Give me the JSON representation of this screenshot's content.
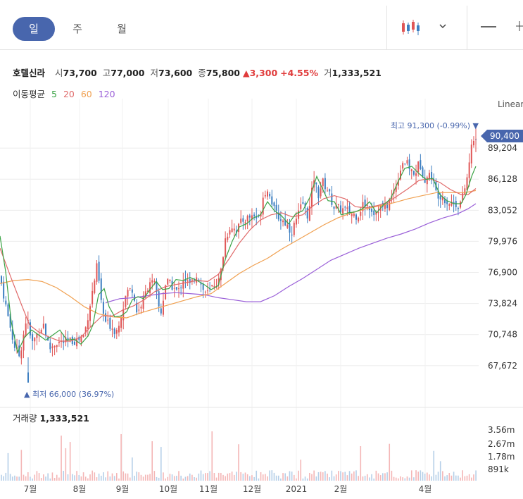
{
  "periods": [
    "일",
    "주",
    "월"
  ],
  "active_period": "일",
  "controls": {
    "chart_type_icon": "candlestick-icon",
    "dropdown_icon": "chevron-down-icon",
    "draw_icon": "line-tool-icon"
  },
  "stock": {
    "name": "호텔신라",
    "open_label": "시",
    "open": "73,700",
    "high_label": "고",
    "high": "77,000",
    "low_label": "저",
    "low": "73,600",
    "close_label": "종",
    "close": "75,800",
    "change": "▲3,300",
    "change_pct": "+4.55%",
    "volume_label": "거",
    "volume": "1,333,521"
  },
  "ma": {
    "label": "이동평균",
    "items": [
      "5",
      "20",
      "60",
      "120"
    ],
    "colors": [
      "#3aa345",
      "#e06a6a",
      "#f0a050",
      "#9a5fd8"
    ]
  },
  "scale_label": "Linear",
  "colors": {
    "up": "#e05656",
    "down": "#3d7fc1",
    "accent": "#4866ad",
    "vol_up": "#f4b6b6",
    "vol_down": "#b5cfe8"
  },
  "chart_data": {
    "type": "candlestick",
    "price_ticks": [
      89204,
      86128,
      83052,
      79976,
      76900,
      73824,
      70748,
      67672
    ],
    "price_tick_labels": [
      "89,204",
      "86,128",
      "83,052",
      "79,976",
      "76,900",
      "73,824",
      "70,748",
      "67,672"
    ],
    "ylim": [
      64800,
      92700
    ],
    "current_price": "90,400",
    "max_label": "최고 91,300 (-0.99%) ▼",
    "min_label": "▲ 최저 66,000 (36.97%)",
    "x_labels": [
      "7월",
      "8월",
      "9월",
      "10월",
      "11월",
      "12월",
      "2021",
      "2월",
      "4월"
    ],
    "volume": {
      "label": "거래량",
      "value": "1,333,521",
      "ticks": [
        "3.56m",
        "2.67m",
        "1.78m",
        "891k"
      ],
      "tick_values": [
        3560000,
        2670000,
        1780000,
        891000
      ]
    },
    "close_path": [
      [
        0,
        76500
      ],
      [
        10,
        73000
      ],
      [
        20,
        69700
      ],
      [
        28,
        68600
      ],
      [
        38,
        72600
      ],
      [
        45,
        69800
      ],
      [
        55,
        71100
      ],
      [
        62,
        71800
      ],
      [
        70,
        69300
      ],
      [
        80,
        70000
      ],
      [
        90,
        70000
      ],
      [
        100,
        70100
      ],
      [
        110,
        70200
      ],
      [
        120,
        70800
      ],
      [
        130,
        74500
      ],
      [
        138,
        77600
      ],
      [
        145,
        73200
      ],
      [
        150,
        72000
      ],
      [
        158,
        71600
      ],
      [
        165,
        71000
      ],
      [
        175,
        73500
      ],
      [
        180,
        75000
      ],
      [
        188,
        75300
      ],
      [
        195,
        72800
      ],
      [
        205,
        74500
      ],
      [
        213,
        76100
      ],
      [
        220,
        75600
      ],
      [
        228,
        72600
      ],
      [
        236,
        76100
      ],
      [
        245,
        75500
      ],
      [
        253,
        74900
      ],
      [
        261,
        76400
      ],
      [
        270,
        75600
      ],
      [
        280,
        76800
      ],
      [
        288,
        75200
      ],
      [
        296,
        74800
      ],
      [
        303,
        75700
      ],
      [
        312,
        76100
      ],
      [
        320,
        80200
      ],
      [
        328,
        81600
      ],
      [
        336,
        81100
      ],
      [
        344,
        82000
      ],
      [
        352,
        82300
      ],
      [
        360,
        82600
      ],
      [
        368,
        82100
      ],
      [
        375,
        85000
      ],
      [
        383,
        84800
      ],
      [
        390,
        82900
      ],
      [
        398,
        82200
      ],
      [
        406,
        81800
      ],
      [
        414,
        80900
      ],
      [
        422,
        82300
      ],
      [
        430,
        83800
      ],
      [
        438,
        82400
      ],
      [
        446,
        86300
      ],
      [
        452,
        84500
      ],
      [
        458,
        85900
      ],
      [
        466,
        85000
      ],
      [
        474,
        83400
      ],
      [
        482,
        83200
      ],
      [
        490,
        83100
      ],
      [
        500,
        82700
      ],
      [
        508,
        82500
      ],
      [
        516,
        83700
      ],
      [
        524,
        83500
      ],
      [
        532,
        82800
      ],
      [
        540,
        83400
      ],
      [
        548,
        83300
      ],
      [
        556,
        84300
      ],
      [
        564,
        85900
      ],
      [
        572,
        87900
      ],
      [
        580,
        87500
      ],
      [
        588,
        86500
      ],
      [
        596,
        87800
      ],
      [
        604,
        86100
      ],
      [
        612,
        86700
      ],
      [
        620,
        84700
      ],
      [
        628,
        84500
      ],
      [
        636,
        83800
      ],
      [
        644,
        83800
      ],
      [
        652,
        83500
      ],
      [
        658,
        84500
      ],
      [
        664,
        86400
      ],
      [
        670,
        89400
      ],
      [
        676,
        90400
      ]
    ],
    "ma5_path": [
      [
        0,
        80500
      ],
      [
        8,
        77000
      ],
      [
        16,
        72000
      ],
      [
        25,
        69000
      ],
      [
        35,
        70500
      ],
      [
        45,
        71200
      ],
      [
        55,
        70700
      ],
      [
        65,
        70200
      ],
      [
        75,
        70700
      ],
      [
        85,
        71200
      ],
      [
        95,
        70200
      ],
      [
        105,
        70300
      ],
      [
        115,
        69800
      ],
      [
        125,
        70600
      ],
      [
        132,
        71700
      ],
      [
        140,
        74700
      ],
      [
        148,
        75300
      ],
      [
        155,
        73500
      ],
      [
        163,
        72500
      ],
      [
        172,
        72600
      ],
      [
        180,
        73000
      ],
      [
        188,
        74200
      ],
      [
        196,
        74500
      ],
      [
        204,
        74300
      ],
      [
        213,
        75200
      ],
      [
        222,
        76000
      ],
      [
        231,
        75200
      ],
      [
        240,
        75300
      ],
      [
        250,
        76200
      ],
      [
        260,
        76100
      ],
      [
        270,
        76400
      ],
      [
        280,
        76100
      ],
      [
        290,
        75700
      ],
      [
        300,
        75200
      ],
      [
        310,
        75600
      ],
      [
        320,
        78200
      ],
      [
        330,
        80000
      ],
      [
        340,
        81400
      ],
      [
        350,
        81700
      ],
      [
        360,
        82300
      ],
      [
        370,
        82600
      ],
      [
        380,
        83900
      ],
      [
        390,
        83000
      ],
      [
        400,
        82500
      ],
      [
        410,
        81700
      ],
      [
        420,
        82700
      ],
      [
        430,
        83000
      ],
      [
        440,
        84300
      ],
      [
        450,
        86400
      ],
      [
        458,
        85200
      ],
      [
        466,
        84000
      ],
      [
        475,
        83900
      ],
      [
        485,
        82600
      ],
      [
        495,
        82800
      ],
      [
        505,
        82900
      ],
      [
        515,
        83200
      ],
      [
        525,
        83900
      ],
      [
        535,
        82800
      ],
      [
        545,
        83600
      ],
      [
        555,
        84200
      ],
      [
        565,
        85800
      ],
      [
        575,
        87200
      ],
      [
        585,
        87400
      ],
      [
        595,
        86700
      ],
      [
        605,
        86100
      ],
      [
        615,
        86200
      ],
      [
        625,
        84600
      ],
      [
        635,
        84000
      ],
      [
        645,
        83700
      ],
      [
        655,
        83700
      ],
      [
        662,
        84600
      ],
      [
        670,
        86400
      ],
      [
        676,
        87400
      ]
    ],
    "ma20_path": [
      [
        0,
        79300
      ],
      [
        15,
        76500
      ],
      [
        30,
        73800
      ],
      [
        42,
        71700
      ],
      [
        55,
        71000
      ],
      [
        70,
        70500
      ],
      [
        85,
        70100
      ],
      [
        100,
        70100
      ],
      [
        115,
        70500
      ],
      [
        130,
        71600
      ],
      [
        145,
        72600
      ],
      [
        160,
        72600
      ],
      [
        175,
        73200
      ],
      [
        190,
        73600
      ],
      [
        205,
        74200
      ],
      [
        220,
        75000
      ],
      [
        235,
        75500
      ],
      [
        250,
        75700
      ],
      [
        265,
        75900
      ],
      [
        280,
        76100
      ],
      [
        295,
        76000
      ],
      [
        310,
        76700
      ],
      [
        325,
        78200
      ],
      [
        340,
        79800
      ],
      [
        355,
        81100
      ],
      [
        370,
        82100
      ],
      [
        385,
        82600
      ],
      [
        400,
        82800
      ],
      [
        415,
        82400
      ],
      [
        430,
        82600
      ],
      [
        445,
        83500
      ],
      [
        460,
        84200
      ],
      [
        475,
        84500
      ],
      [
        490,
        84200
      ],
      [
        505,
        83400
      ],
      [
        520,
        83300
      ],
      [
        535,
        83500
      ],
      [
        550,
        83800
      ],
      [
        565,
        84500
      ],
      [
        580,
        85200
      ],
      [
        595,
        86000
      ],
      [
        610,
        86200
      ],
      [
        625,
        85800
      ],
      [
        640,
        85100
      ],
      [
        655,
        84600
      ],
      [
        665,
        84600
      ],
      [
        676,
        85200
      ]
    ],
    "ma60_path": [
      [
        0,
        75800
      ],
      [
        20,
        76100
      ],
      [
        40,
        76200
      ],
      [
        60,
        76000
      ],
      [
        80,
        75400
      ],
      [
        100,
        74500
      ],
      [
        120,
        73500
      ],
      [
        140,
        72800
      ],
      [
        160,
        72500
      ],
      [
        180,
        72400
      ],
      [
        200,
        72900
      ],
      [
        220,
        73300
      ],
      [
        240,
        73700
      ],
      [
        260,
        74100
      ],
      [
        280,
        74500
      ],
      [
        300,
        74800
      ],
      [
        320,
        75800
      ],
      [
        340,
        76800
      ],
      [
        360,
        77600
      ],
      [
        380,
        78300
      ],
      [
        400,
        79200
      ],
      [
        420,
        80000
      ],
      [
        440,
        80800
      ],
      [
        460,
        81600
      ],
      [
        480,
        82300
      ],
      [
        500,
        82800
      ],
      [
        520,
        83200
      ],
      [
        540,
        83500
      ],
      [
        560,
        83800
      ],
      [
        580,
        84200
      ],
      [
        600,
        84500
      ],
      [
        620,
        84800
      ],
      [
        640,
        84800
      ],
      [
        660,
        84800
      ],
      [
        676,
        85000
      ]
    ],
    "ma120_path": [
      [
        150,
        73900
      ],
      [
        170,
        74300
      ],
      [
        190,
        74400
      ],
      [
        210,
        74600
      ],
      [
        230,
        74800
      ],
      [
        250,
        74900
      ],
      [
        270,
        74800
      ],
      [
        290,
        74700
      ],
      [
        310,
        74400
      ],
      [
        330,
        74200
      ],
      [
        350,
        74000
      ],
      [
        370,
        74000
      ],
      [
        390,
        74600
      ],
      [
        410,
        75500
      ],
      [
        430,
        76300
      ],
      [
        450,
        77200
      ],
      [
        470,
        78100
      ],
      [
        490,
        78700
      ],
      [
        510,
        79300
      ],
      [
        530,
        79800
      ],
      [
        550,
        80300
      ],
      [
        570,
        80700
      ],
      [
        590,
        81200
      ],
      [
        610,
        81800
      ],
      [
        630,
        82300
      ],
      [
        650,
        82700
      ],
      [
        665,
        83200
      ],
      [
        676,
        83700
      ]
    ]
  }
}
